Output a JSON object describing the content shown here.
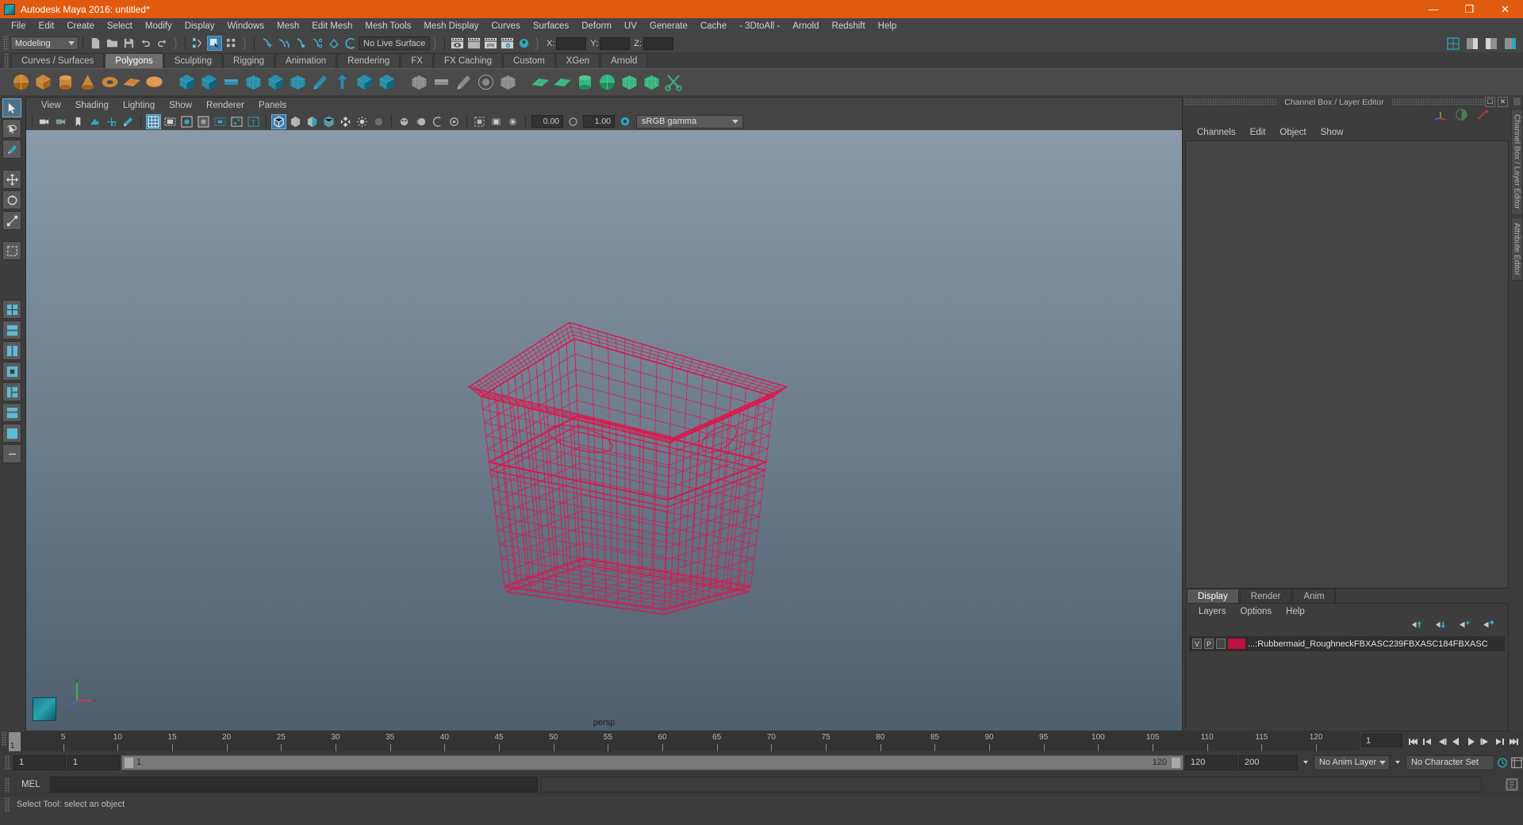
{
  "window": {
    "title": "Autodesk Maya 2016: untitled*",
    "minimize": "—",
    "maximize": "❐",
    "close": "✕"
  },
  "menubar": {
    "items": [
      "File",
      "Edit",
      "Create",
      "Select",
      "Modify",
      "Display",
      "Windows",
      "Mesh",
      "Edit Mesh",
      "Mesh Tools",
      "Mesh Display",
      "Curves",
      "Surfaces",
      "Deform",
      "UV",
      "Generate",
      "Cache",
      "- 3DtoAll -",
      "Arnold",
      "Redshift",
      "Help"
    ]
  },
  "statusbar": {
    "mode": "Modeling",
    "live_surface": "No Live Surface",
    "x_label": "X:",
    "y_label": "Y:",
    "z_label": "Z:",
    "x_value": "",
    "y_value": "",
    "z_value": ""
  },
  "shelf": {
    "tabs": [
      {
        "label": "Curves / Surfaces",
        "active": false
      },
      {
        "label": "Polygons",
        "active": true
      },
      {
        "label": "Sculpting",
        "active": false
      },
      {
        "label": "Rigging",
        "active": false
      },
      {
        "label": "Animation",
        "active": false
      },
      {
        "label": "Rendering",
        "active": false
      },
      {
        "label": "FX",
        "active": false
      },
      {
        "label": "FX Caching",
        "active": false
      },
      {
        "label": "Custom",
        "active": false
      },
      {
        "label": "XGen",
        "active": false
      },
      {
        "label": "Arnold",
        "active": false
      }
    ]
  },
  "viewport": {
    "menus": [
      "View",
      "Shading",
      "Lighting",
      "Show",
      "Renderer",
      "Panels"
    ],
    "exposure": "0.00",
    "gamma": "1.00",
    "color_profile": "sRGB gamma",
    "camera_label": "persp",
    "axis_x": "x",
    "axis_y": "y",
    "axis_z": "z",
    "wireframe_color": "#e0144b",
    "bg_top": "#8a9aa8",
    "bg_bottom": "#4f5f6e"
  },
  "channelbox": {
    "panel_title": "Channel Box / Layer Editor",
    "menus": [
      "Channels",
      "Edit",
      "Object",
      "Show"
    ],
    "vertical_tabs": [
      "Channel Box / Layer Editor",
      "Attribute Editor"
    ]
  },
  "layer_editor": {
    "tabs": [
      {
        "label": "Display",
        "active": true
      },
      {
        "label": "Render",
        "active": false
      },
      {
        "label": "Anim",
        "active": false
      }
    ],
    "menus": [
      "Layers",
      "Options",
      "Help"
    ],
    "layers": [
      {
        "visibility": "V",
        "playback": "P",
        "color": "#c0103c",
        "name": "...:Rubbermaid_RoughneckFBXASC239FBXASC184FBXASC"
      }
    ]
  },
  "timeline": {
    "ticks": [
      5,
      10,
      15,
      20,
      25,
      30,
      35,
      40,
      45,
      50,
      55,
      60,
      65,
      70,
      75,
      80,
      85,
      90,
      95,
      100,
      105,
      110,
      115,
      120
    ],
    "current_frame": "1",
    "frame_field": "1",
    "range_start": "1",
    "range_end": "1",
    "slider_start": "1",
    "slider_end": "120",
    "anim_start": "120",
    "anim_end": "200",
    "anim_layer": "No Anim Layer",
    "character_set": "No Character Set"
  },
  "command_line": {
    "language": "MEL",
    "input_value": "",
    "output_value": ""
  },
  "status_line": {
    "message": "Select Tool: select an object"
  }
}
